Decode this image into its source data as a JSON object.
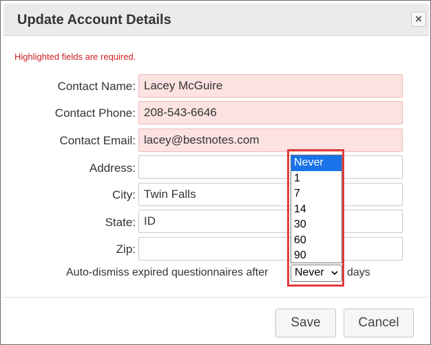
{
  "dialog": {
    "title": "Update Account Details",
    "close_glyph": "×"
  },
  "form": {
    "required_note": "Highlighted fields are required.",
    "fields": [
      {
        "label": "Contact Name:",
        "value": "Lacey McGuire",
        "required": true
      },
      {
        "label": "Contact Phone:",
        "value": "208-543-6646",
        "required": true
      },
      {
        "label": "Contact Email:",
        "value": "lacey@bestnotes.com",
        "required": true
      },
      {
        "label": "Address:",
        "value": "",
        "required": false
      },
      {
        "label": "City:",
        "value": "Twin Falls",
        "required": false
      },
      {
        "label": "State:",
        "value": "ID",
        "required": false
      },
      {
        "label": "Zip:",
        "value": "",
        "required": false
      }
    ],
    "auto_dismiss": {
      "prefix": "Auto-dismiss expired questionnaires after",
      "suffix": "days",
      "selected": "Never",
      "options": [
        "Never",
        "1",
        "7",
        "14",
        "30",
        "60",
        "90"
      ]
    }
  },
  "footer": {
    "save_label": "Save",
    "cancel_label": "Cancel"
  },
  "colors": {
    "required_bg": "#fde2e2",
    "required_note": "#cc1f1f",
    "option_highlight": "#1a73e8",
    "annotation_box": "#e03c3c"
  }
}
